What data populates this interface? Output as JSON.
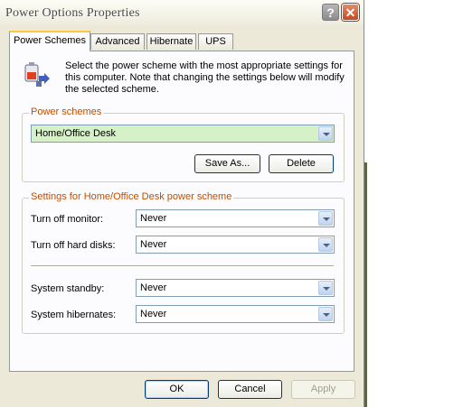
{
  "window": {
    "title": "Power Options Properties"
  },
  "titlebar": {
    "help_glyph": "?",
    "close_glyph": "✕"
  },
  "tabs": [
    {
      "label": "Power Schemes"
    },
    {
      "label": "Advanced"
    },
    {
      "label": "Hibernate"
    },
    {
      "label": "UPS"
    }
  ],
  "intro": {
    "icon": "power-scheme-icon",
    "text": "Select the power scheme with the most appropriate settings for this computer. Note that changing the settings below will modify the selected scheme."
  },
  "power_schemes": {
    "group_title": "Power schemes",
    "selected": "Home/Office Desk",
    "save_as_label": "Save As...",
    "delete_label": "Delete"
  },
  "settings": {
    "group_title": "Settings for Home/Office Desk power scheme",
    "rows": [
      {
        "label": "Turn off monitor:",
        "value": "Never"
      },
      {
        "label": "Turn off hard disks:",
        "value": "Never"
      },
      {
        "label": "System standby:",
        "value": "Never"
      },
      {
        "label": "System hibernates:",
        "value": "Never"
      }
    ]
  },
  "footer": {
    "ok_label": "OK",
    "cancel_label": "Cancel",
    "apply_label": "Apply"
  },
  "colors": {
    "group_title": "#c04e00",
    "tab_highlight": "#ffc73c",
    "combo_border": "#7f9db9"
  }
}
